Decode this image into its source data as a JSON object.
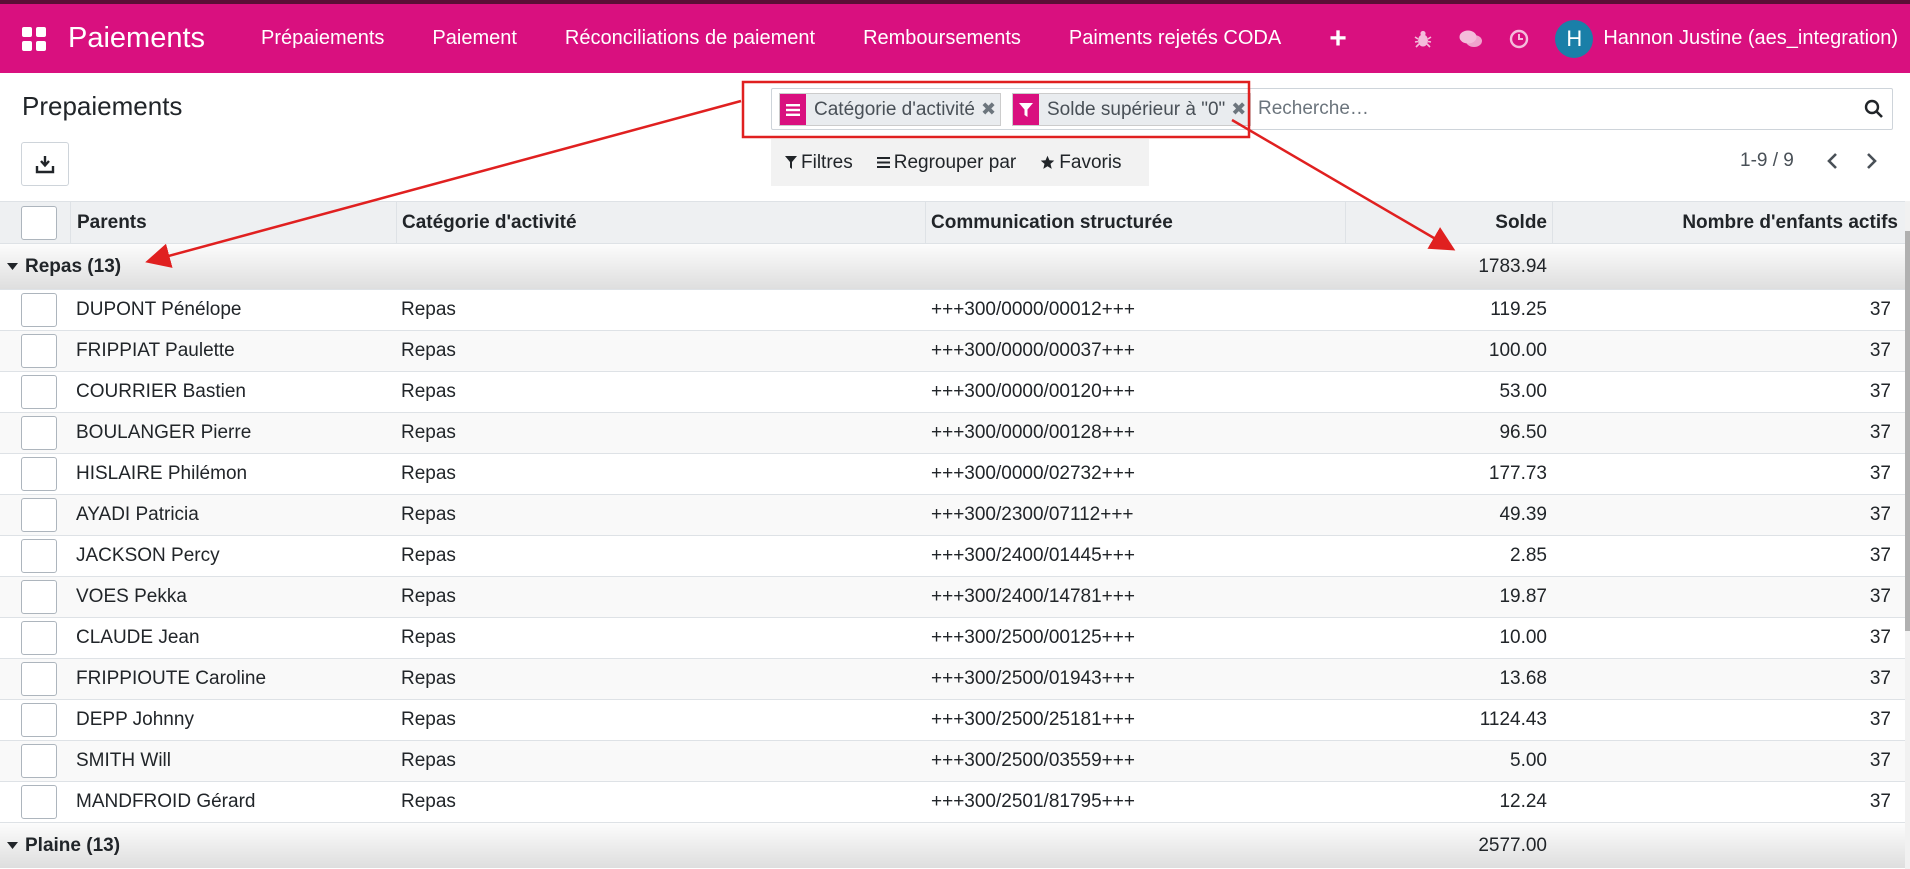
{
  "navbar": {
    "brand": "Paiements",
    "menu": [
      "Prépaiements",
      "Paiement",
      "Réconciliations de paiement",
      "Remboursements",
      "Paiments rejetés CODA"
    ],
    "plus": "+",
    "user": "Hannon Justine (aes_integration)",
    "avatar_letter": "H"
  },
  "page": {
    "title": "Prepaiements"
  },
  "search": {
    "facets": [
      "Catégorie d'activité",
      "Solde supérieur à \"0\""
    ],
    "placeholder": "Recherche…"
  },
  "filters": {
    "filtres": "Filtres",
    "regrouper": "Regrouper par",
    "favoris": "Favoris"
  },
  "pager": {
    "range": "1-9 / 9"
  },
  "table": {
    "columns": [
      "Parents",
      "Catégorie d'activité",
      "Communication structurée",
      "Solde",
      "Nombre d'enfants actifs"
    ],
    "groups": [
      {
        "label": "Repas (13)",
        "total": "1783.94",
        "rows": [
          [
            "DUPONT Pénélope",
            "Repas",
            "+++300/0000/00012+++",
            "119.25",
            "37"
          ],
          [
            "FRIPPIAT Paulette",
            "Repas",
            "+++300/0000/00037+++",
            "100.00",
            "37"
          ],
          [
            "COURRIER Bastien",
            "Repas",
            "+++300/0000/00120+++",
            "53.00",
            "37"
          ],
          [
            "BOULANGER Pierre",
            "Repas",
            "+++300/0000/00128+++",
            "96.50",
            "37"
          ],
          [
            "HISLAIRE Philémon",
            "Repas",
            "+++300/0000/02732+++",
            "177.73",
            "37"
          ],
          [
            "AYADI Patricia",
            "Repas",
            "+++300/2300/07112+++",
            "49.39",
            "37"
          ],
          [
            "JACKSON Percy",
            "Repas",
            "+++300/2400/01445+++",
            "2.85",
            "37"
          ],
          [
            "VOES Pekka",
            "Repas",
            "+++300/2400/14781+++",
            "19.87",
            "37"
          ],
          [
            "CLAUDE Jean",
            "Repas",
            "+++300/2500/00125+++",
            "10.00",
            "37"
          ],
          [
            "FRIPPIOUTE Caroline",
            "Repas",
            "+++300/2500/01943+++",
            "13.68",
            "37"
          ],
          [
            "DEPP Johnny",
            "Repas",
            "+++300/2500/25181+++",
            "1124.43",
            "37"
          ],
          [
            "SMITH Will",
            "Repas",
            "+++300/2500/03559+++",
            "5.00",
            "37"
          ],
          [
            "MANDFROID Gérard",
            "Repas",
            "+++300/2501/81795+++",
            "12.24",
            "37"
          ]
        ]
      },
      {
        "label": "Plaine (13)",
        "total": "2577.00",
        "rows": []
      }
    ]
  },
  "colors": {
    "brand": "#d9107f",
    "brand_dark": "#5a0f36",
    "annotation": "#e02020"
  }
}
